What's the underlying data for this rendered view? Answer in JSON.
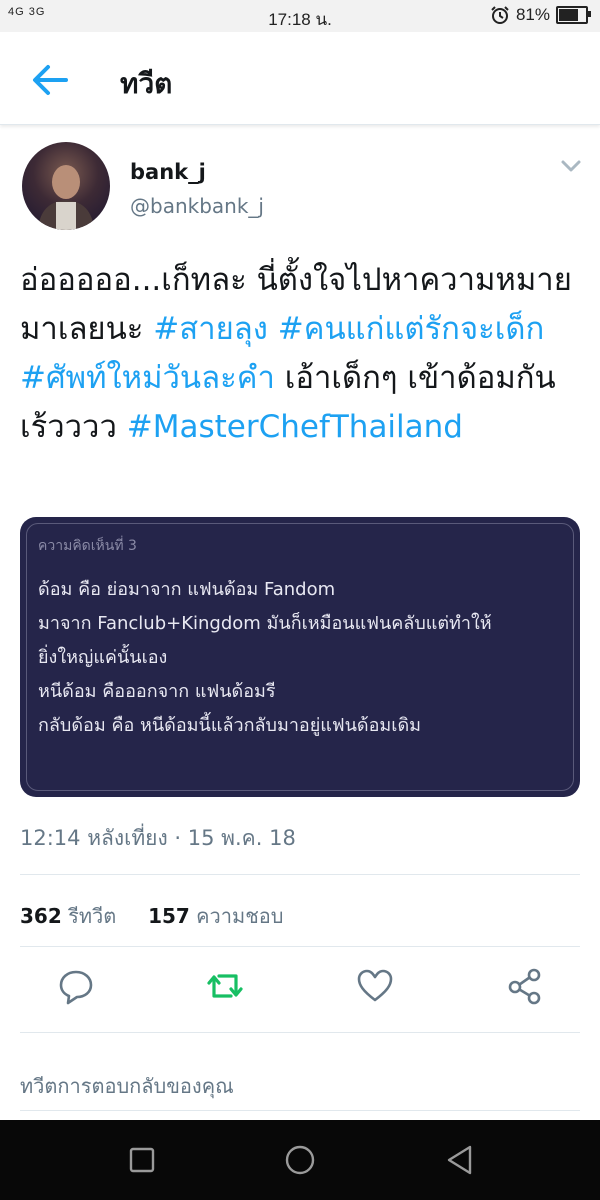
{
  "status_bar": {
    "signal": "4G 3G",
    "time": "17:18 น.",
    "battery_percent_text": "81%",
    "battery_level": 0.81,
    "alarm_icon": "alarm-clock-icon"
  },
  "header": {
    "back_icon": "arrow-left-icon",
    "title": "ทวีต"
  },
  "tweet": {
    "author_name": "bank_j",
    "author_handle": "@bankbank_j",
    "text_segments": [
      {
        "text": "อ่อออออ...เก็ทละ นี่ตั้งใจไปหาความหมายมาเลยนะ ",
        "hashtag": false
      },
      {
        "text": "#สายลุง",
        "hashtag": true
      },
      {
        "text": " ",
        "hashtag": false
      },
      {
        "text": "#คนแก่แต่รักจะเด็ก",
        "hashtag": true
      },
      {
        "text": " ",
        "hashtag": false
      },
      {
        "text": "#ศัพท์ใหม่วันละคำ",
        "hashtag": true
      },
      {
        "text": " เอ้าเด็กๆ เข้าด้อมกันเร้วววว ",
        "hashtag": false
      },
      {
        "text": "#MasterChefThailand",
        "hashtag": true
      }
    ],
    "attachment": {
      "header": "ความคิดเห็นที่ 3",
      "lines": [
        "ด้อม คือ ย่อมาจาก แฟนด้อม Fandom",
        "มาจาก Fanclub+Kingdom มันก็เหมือนแฟนคลับแต่ทำให้",
        "ยิ่งใหญ่แค่นั้นเอง",
        "หนีด้อม คือออกจาก แฟนด้อมรี",
        "กลับด้อม คือ หนีด้อมนี้แล้วกลับมาอยู่แฟนด้อมเดิม"
      ]
    },
    "timestamp": "12:14 หลังเที่ยง · 15 พ.ค. 18",
    "retweet_count": "362",
    "retweet_label": "รีทวีต",
    "like_count": "157",
    "like_label": "ความชอบ"
  },
  "actions": {
    "reply_icon": "reply-bubble-icon",
    "retweet_icon": "retweet-icon",
    "like_icon": "heart-icon",
    "share_icon": "share-icon"
  },
  "reply_box": {
    "placeholder": "ทวีตการตอบกลับของคุณ"
  },
  "nav_bar": {
    "buttons": [
      "recent-apps-icon",
      "home-icon",
      "back-triangle-icon"
    ]
  },
  "colors": {
    "accent": "#1da1f2",
    "retweet_active": "#17bf63",
    "attachment_bg": "#25254a"
  }
}
